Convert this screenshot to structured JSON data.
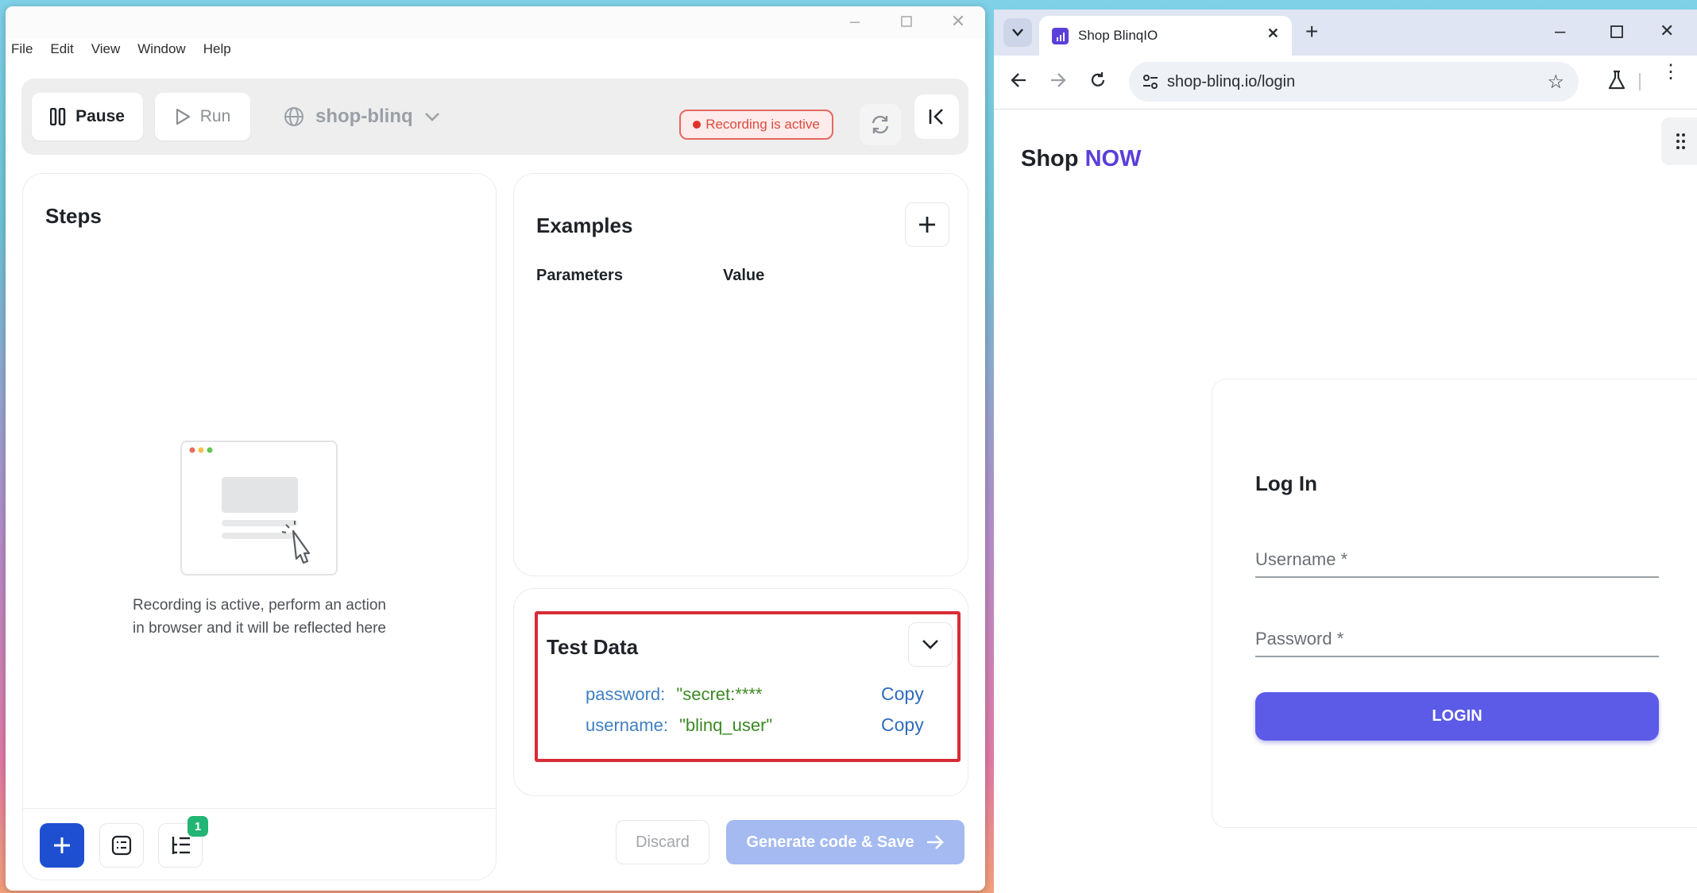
{
  "recorder": {
    "menu": [
      "File",
      "Edit",
      "View",
      "Window",
      "Help"
    ],
    "toolbar": {
      "pause_label": "Pause",
      "run_label": "Run",
      "project": "shop-blinq",
      "recording_badge": "Recording is active"
    },
    "steps": {
      "title": "Steps",
      "empty_line1": "Recording is active, perform an action",
      "empty_line2": "in browser and it will be reflected here",
      "badge_count": "1"
    },
    "examples": {
      "title": "Examples",
      "col_parameters": "Parameters",
      "col_value": "Value"
    },
    "test_data": {
      "title": "Test Data",
      "rows": [
        {
          "key": "password:",
          "value": "\"secret:****",
          "copy": "Copy"
        },
        {
          "key": "username:",
          "value": "\"blinq_user\"",
          "copy": "Copy"
        }
      ]
    },
    "footer": {
      "discard": "Discard",
      "generate": "Generate code & Save"
    }
  },
  "browser": {
    "tab_title": "Shop BlinqIO",
    "url": "shop-blinq.io/login",
    "page": {
      "brand_shop": "Shop",
      "brand_now": "NOW",
      "login_title": "Log In",
      "username_label": "Username *",
      "password_label": "Password *",
      "login_button": "LOGIN"
    }
  },
  "colors": {
    "accent_blue": "#1e4fd0",
    "login_purple": "#5b5be8",
    "brand_now": "#5b3fd9",
    "record_red": "#e0322a",
    "highlight_red": "#d82c37",
    "badge_green": "#22b573"
  }
}
